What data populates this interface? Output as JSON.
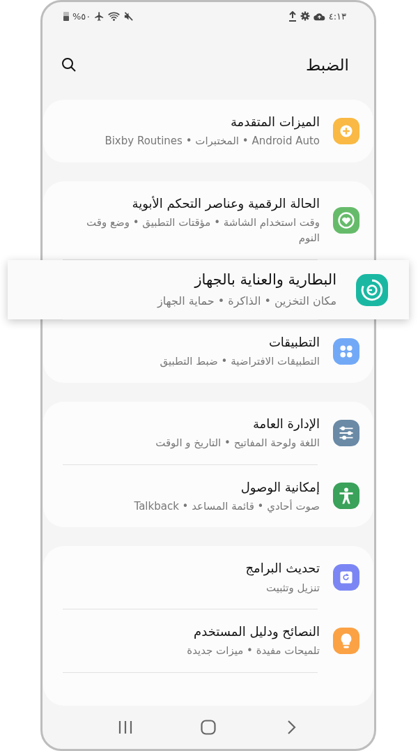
{
  "status_bar": {
    "battery": "%٥٠",
    "time": "٤:١٣"
  },
  "header": {
    "title": "الضبط"
  },
  "groups": [
    {
      "items": [
        {
          "title": "الميزات المتقدمة",
          "subtitle": "Android Auto • المختبرات • Bixby Routines",
          "color": "#f9b944",
          "highlighted": false
        }
      ]
    },
    {
      "items": [
        {
          "title": "الحالة الرقمية وعناصر التحكم الأبوية",
          "subtitle": "وقت استخدام الشاشة • مؤقتات التطبيق • وضع وقت النوم",
          "color": "#66bb6a",
          "highlighted": false
        },
        {
          "title": "البطارية والعناية بالجهاز",
          "subtitle": "مكان التخزين • الذاكرة • حماية الجهاز",
          "color": "#1ab8a3",
          "highlighted": true
        },
        {
          "title": "التطبيقات",
          "subtitle": "التطبيقات الافتراضية • ضبط التطبيق",
          "color": "#72a9f7",
          "highlighted": false
        }
      ]
    },
    {
      "items": [
        {
          "title": "الإدارة العامة",
          "subtitle": "اللغة ولوحة المفاتيح • التاريخ و الوقت",
          "color": "#6a8aa6",
          "highlighted": false
        },
        {
          "title": "إمكانية الوصول",
          "subtitle": "صوت أحادي • قائمة المساعد • Talkback",
          "color": "#3aa25a",
          "highlighted": false
        }
      ]
    },
    {
      "items": [
        {
          "title": "تحديث البرامج",
          "subtitle": "تنزيل وتثبيت",
          "color": "#7b86f4",
          "highlighted": false
        },
        {
          "title": "النصائح ودليل المستخدم",
          "subtitle": "تلميحات مفيدة • ميزات جديدة",
          "color": "#fba245",
          "highlighted": false
        }
      ]
    }
  ]
}
